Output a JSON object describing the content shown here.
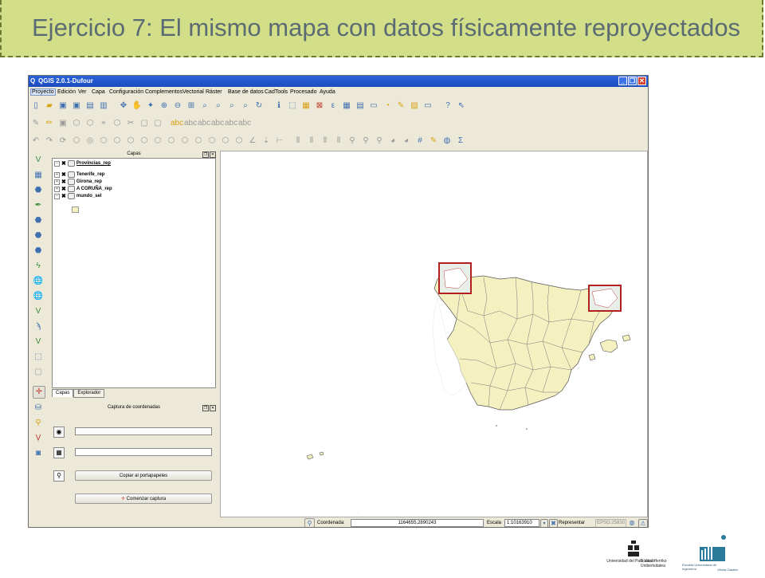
{
  "slide": {
    "title": "Ejercicio 7: El mismo mapa con datos físicamente reproyectados"
  },
  "window": {
    "title": "QGIS 2.0.1-Dufour",
    "menu": [
      "Proyecto",
      "Edición",
      "Ver",
      "Capa",
      "Configuración",
      "Complementos",
      "Vectorial",
      "Ráster",
      "Base de datos",
      "CadTools",
      "Procesado",
      "Ayuda"
    ],
    "active_menu": "Proyecto"
  },
  "layers_panel": {
    "title": "Capas",
    "layers": [
      {
        "name": "Provincias_rep",
        "checked": true,
        "underlined": true
      },
      {
        "name": "Tenerife_rep",
        "checked": true
      },
      {
        "name": "Girona_rep",
        "checked": true
      },
      {
        "name": "A CORUÑA_rep",
        "checked": true
      },
      {
        "name": "mundo_sel",
        "checked": true
      }
    ],
    "tabs": [
      "Capas",
      "Explorador"
    ]
  },
  "coords_panel": {
    "title": "Captura de coordenadas",
    "copy_button": "Copiar al portapapeles",
    "start_button": "Comenzar captura"
  },
  "status": {
    "coord_label": "Coordenada:",
    "coord_value": "1164655,2890243",
    "scale_label": "Escala",
    "scale_value": "1:10163910",
    "render_label": "Representar",
    "crs": "EPSG:25830"
  },
  "colors": {
    "land": "#f4f0c0",
    "raster_frame": "#b0201e",
    "banner": "#d3df88"
  },
  "logos": {
    "upv": [
      "Universidad del País Vasco",
      "Euskal Herriko Unibertsitatea"
    ],
    "school": [
      "Escuela Universitaria de Ingeniería",
      "Vitoria-Gasteiz"
    ]
  }
}
